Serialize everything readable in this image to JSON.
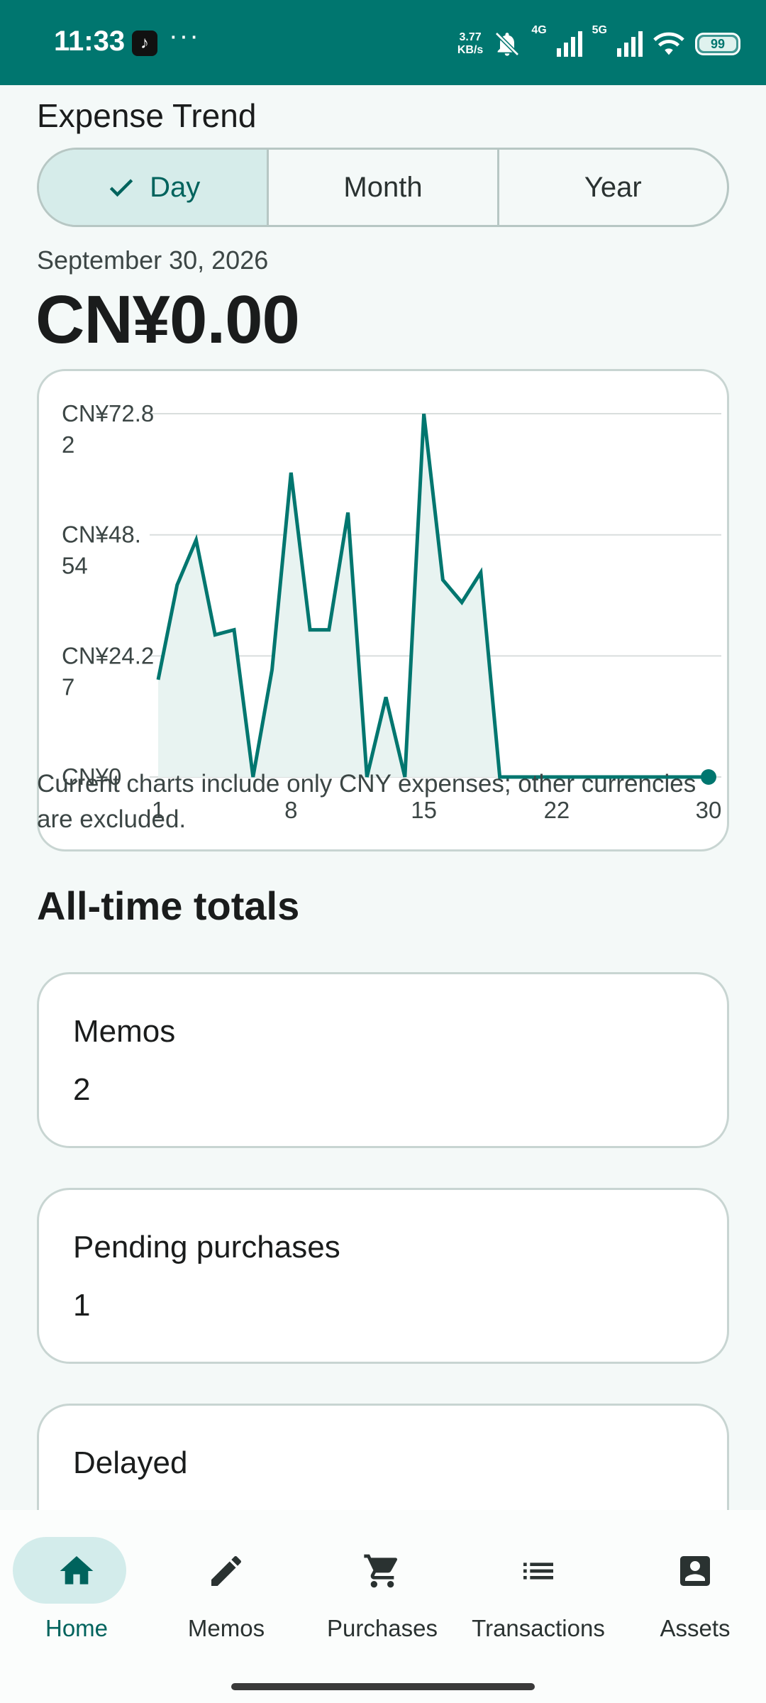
{
  "status_bar": {
    "time": "11:33",
    "app_icon": "tiktok-icon",
    "more": "···",
    "net_speed_value": "3.77",
    "net_speed_unit": "KB/s",
    "net_1": "4G",
    "net_2": "5G",
    "battery": "99",
    "background_color": "#00766f"
  },
  "expense_trend": {
    "title": "Expense Trend",
    "tabs": [
      {
        "label": "Day",
        "selected": true
      },
      {
        "label": "Month",
        "selected": false
      },
      {
        "label": "Year",
        "selected": false
      }
    ],
    "date": "September 30, 2026",
    "amount": "CN¥0.00",
    "note": "Current charts include only CNY expenses; other currencies are excluded."
  },
  "chart_data": {
    "type": "area",
    "y_tick_labels": [
      [
        "CN¥72.8",
        "2"
      ],
      [
        "CN¥48.",
        "54"
      ],
      [
        "CN¥24.2",
        "7"
      ],
      [
        "CN¥0"
      ]
    ],
    "y_ticks": [
      72.82,
      48.54,
      24.27,
      0
    ],
    "ylim": [
      0,
      72.82
    ],
    "x_tick_labels": [
      "1",
      "8",
      "15",
      "22",
      "30"
    ],
    "x_ticks": [
      1,
      8,
      15,
      22,
      30
    ],
    "xlim": [
      1,
      30
    ],
    "x": [
      1,
      2,
      3,
      4,
      5,
      6,
      7,
      8,
      9,
      10,
      11,
      12,
      13,
      14,
      15,
      16,
      17,
      18,
      19,
      20,
      21,
      22,
      23,
      24,
      25,
      26,
      27,
      28,
      29,
      30
    ],
    "values": [
      19.5,
      38.5,
      47.5,
      28.5,
      29.5,
      0,
      21.5,
      61,
      29.5,
      29.5,
      53,
      0,
      16,
      0,
      72.8,
      39.5,
      35,
      41,
      0,
      0,
      0,
      0,
      0,
      0,
      0,
      0,
      0,
      0,
      0,
      0
    ],
    "grid": true,
    "highlight_x": 30,
    "line_color": "#00766f",
    "fill_color": "#e8f3f1"
  },
  "totals": {
    "title": "All-time totals",
    "cards": [
      {
        "label": "Memos",
        "value": "2"
      },
      {
        "label": "Pending purchases",
        "value": "1"
      },
      {
        "label": "Delayed",
        "value": ""
      }
    ]
  },
  "bottom_nav": {
    "items": [
      {
        "label": "Home",
        "icon": "home-icon",
        "active": true
      },
      {
        "label": "Memos",
        "icon": "pencil-icon",
        "active": false
      },
      {
        "label": "Purchases",
        "icon": "cart-icon",
        "active": false
      },
      {
        "label": "Transactions",
        "icon": "list-icon",
        "active": false
      },
      {
        "label": "Assets",
        "icon": "account-box-icon",
        "active": false
      }
    ],
    "active_color": "#00635d"
  }
}
